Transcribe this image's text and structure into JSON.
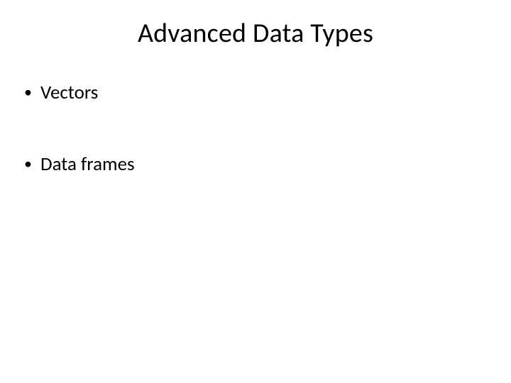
{
  "slide": {
    "title": "Advanced Data Types",
    "bullets": [
      {
        "text": "Vectors"
      },
      {
        "text": "Data frames"
      }
    ]
  }
}
